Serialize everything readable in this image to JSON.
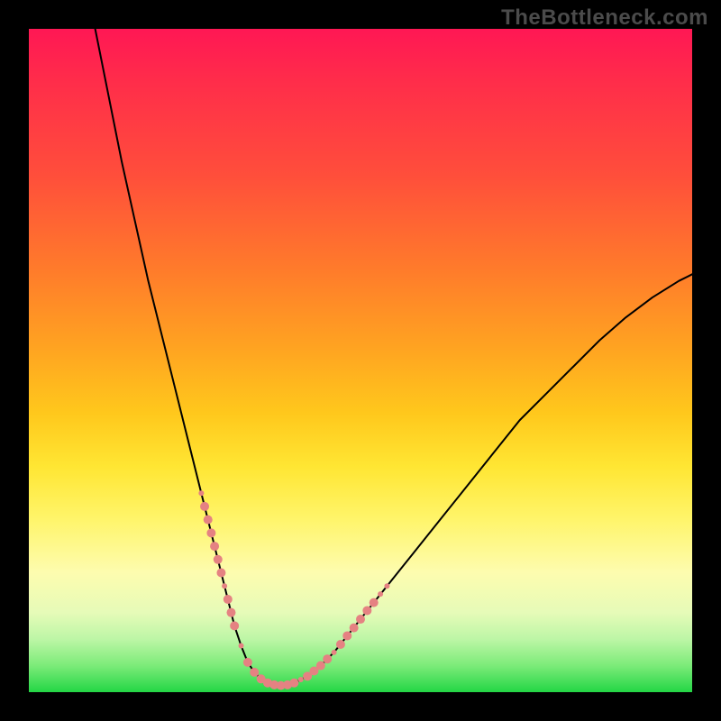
{
  "watermark": "TheBottleneck.com",
  "chart_data": {
    "type": "line",
    "title": "",
    "xlabel": "",
    "ylabel": "",
    "xlim": [
      0,
      100
    ],
    "ylim": [
      0,
      100
    ],
    "grid": false,
    "annotations": [],
    "series": [
      {
        "name": "bottleneck-curve",
        "color": "#000000",
        "x": [
          10,
          12,
          14,
          16,
          18,
          20,
          22,
          24,
          25,
          26,
          27,
          28,
          29,
          30,
          31,
          32,
          33,
          34,
          35,
          36,
          37,
          38,
          39,
          40,
          42,
          44,
          46,
          48,
          50,
          54,
          58,
          62,
          66,
          70,
          74,
          78,
          82,
          86,
          90,
          94,
          98,
          100
        ],
        "y": [
          100,
          90,
          80,
          71,
          62,
          54,
          46,
          38,
          34,
          30,
          26,
          22,
          18,
          14,
          10,
          7,
          4.5,
          3,
          2,
          1.4,
          1.1,
          1,
          1.1,
          1.4,
          2.4,
          4,
          6,
          8.5,
          11,
          16,
          21,
          26,
          31,
          36,
          41,
          45,
          49,
          53,
          56.5,
          59.5,
          62,
          63
        ]
      }
    ],
    "highlight_band": {
      "name": "near-zero-highlight",
      "color": "#e58282",
      "radius_small": 3,
      "radius_large": 5,
      "points": [
        {
          "x": 26,
          "y": 30,
          "r": "small"
        },
        {
          "x": 26.5,
          "y": 28,
          "r": "large"
        },
        {
          "x": 27,
          "y": 26,
          "r": "large"
        },
        {
          "x": 27.5,
          "y": 24,
          "r": "large"
        },
        {
          "x": 28,
          "y": 22,
          "r": "large"
        },
        {
          "x": 28.5,
          "y": 20,
          "r": "large"
        },
        {
          "x": 29,
          "y": 18,
          "r": "large"
        },
        {
          "x": 29.5,
          "y": 16,
          "r": "small"
        },
        {
          "x": 30,
          "y": 14,
          "r": "large"
        },
        {
          "x": 30.5,
          "y": 12,
          "r": "large"
        },
        {
          "x": 31,
          "y": 10,
          "r": "large"
        },
        {
          "x": 32,
          "y": 7,
          "r": "small"
        },
        {
          "x": 33,
          "y": 4.5,
          "r": "large"
        },
        {
          "x": 34,
          "y": 3,
          "r": "large"
        },
        {
          "x": 35,
          "y": 2,
          "r": "large"
        },
        {
          "x": 36,
          "y": 1.4,
          "r": "large"
        },
        {
          "x": 37,
          "y": 1.1,
          "r": "large"
        },
        {
          "x": 38,
          "y": 1,
          "r": "large"
        },
        {
          "x": 39,
          "y": 1.1,
          "r": "large"
        },
        {
          "x": 40,
          "y": 1.4,
          "r": "large"
        },
        {
          "x": 41,
          "y": 1.9,
          "r": "small"
        },
        {
          "x": 42,
          "y": 2.4,
          "r": "large"
        },
        {
          "x": 43,
          "y": 3.2,
          "r": "large"
        },
        {
          "x": 44,
          "y": 4,
          "r": "large"
        },
        {
          "x": 45,
          "y": 5,
          "r": "large"
        },
        {
          "x": 46,
          "y": 6,
          "r": "small"
        },
        {
          "x": 47,
          "y": 7.2,
          "r": "large"
        },
        {
          "x": 48,
          "y": 8.5,
          "r": "large"
        },
        {
          "x": 49,
          "y": 9.7,
          "r": "large"
        },
        {
          "x": 50,
          "y": 11,
          "r": "large"
        },
        {
          "x": 51,
          "y": 12.3,
          "r": "large"
        },
        {
          "x": 52,
          "y": 13.5,
          "r": "large"
        },
        {
          "x": 53,
          "y": 14.8,
          "r": "small"
        },
        {
          "x": 54,
          "y": 16,
          "r": "small"
        }
      ]
    }
  }
}
